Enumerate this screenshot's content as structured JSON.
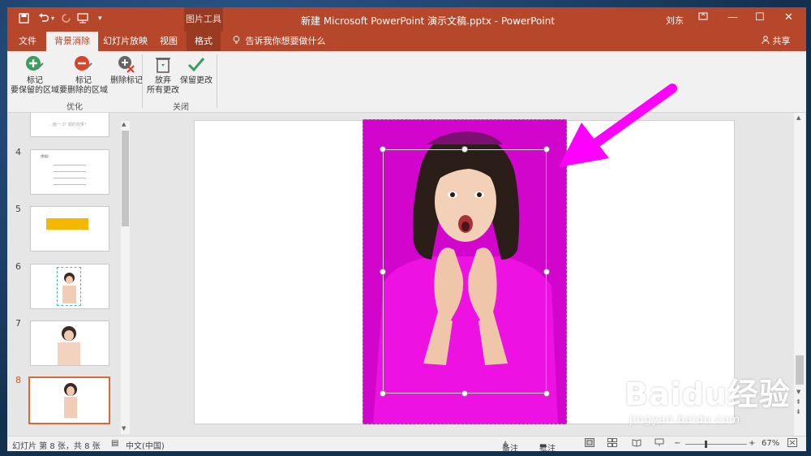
{
  "colors": {
    "accent": "#b7472a",
    "accent_dark": "#9a3a22",
    "removal_magenta": "#d205cc",
    "arrow": "#ff00ff",
    "selected_thumb": "#d56a3d"
  },
  "titlebar": {
    "picture_tools": "图片工具",
    "title": "新建 Microsoft PowerPoint 演示文稿.pptx  -  PowerPoint",
    "user": "刘东"
  },
  "tabs": {
    "file": "文件",
    "background_removal": "背景消除",
    "slideshow": "幻灯片放映",
    "view": "视图",
    "format": "格式",
    "tellme": "告诉我你想要做什么",
    "share": "共享"
  },
  "ribbon": {
    "mark_keep_line1": "标记",
    "mark_keep_line2": "要保留的区域",
    "mark_remove_line1": "标记",
    "mark_remove_line2": "要删除的区域",
    "delete_mark": "删除标记",
    "group_refine": "优化",
    "discard_line1": "放弃",
    "discard_line2": "所有更改",
    "keep_changes": "保留更改",
    "group_close": "关闭"
  },
  "slides": {
    "partial_text": "…面一 3° 期的效果！",
    "numbers": [
      "4",
      "5",
      "6",
      "7",
      "8"
    ],
    "thumb4_title": "（数据）",
    "selected": "8"
  },
  "status": {
    "slide_info": "幻灯片 第 8 张，共 8 张",
    "language": "中文(中国)",
    "notes": "备注",
    "comments": "批注",
    "zoom": "67%"
  },
  "watermark": {
    "logo": "Baidu经验",
    "url": "jingyan.baidu.com"
  }
}
